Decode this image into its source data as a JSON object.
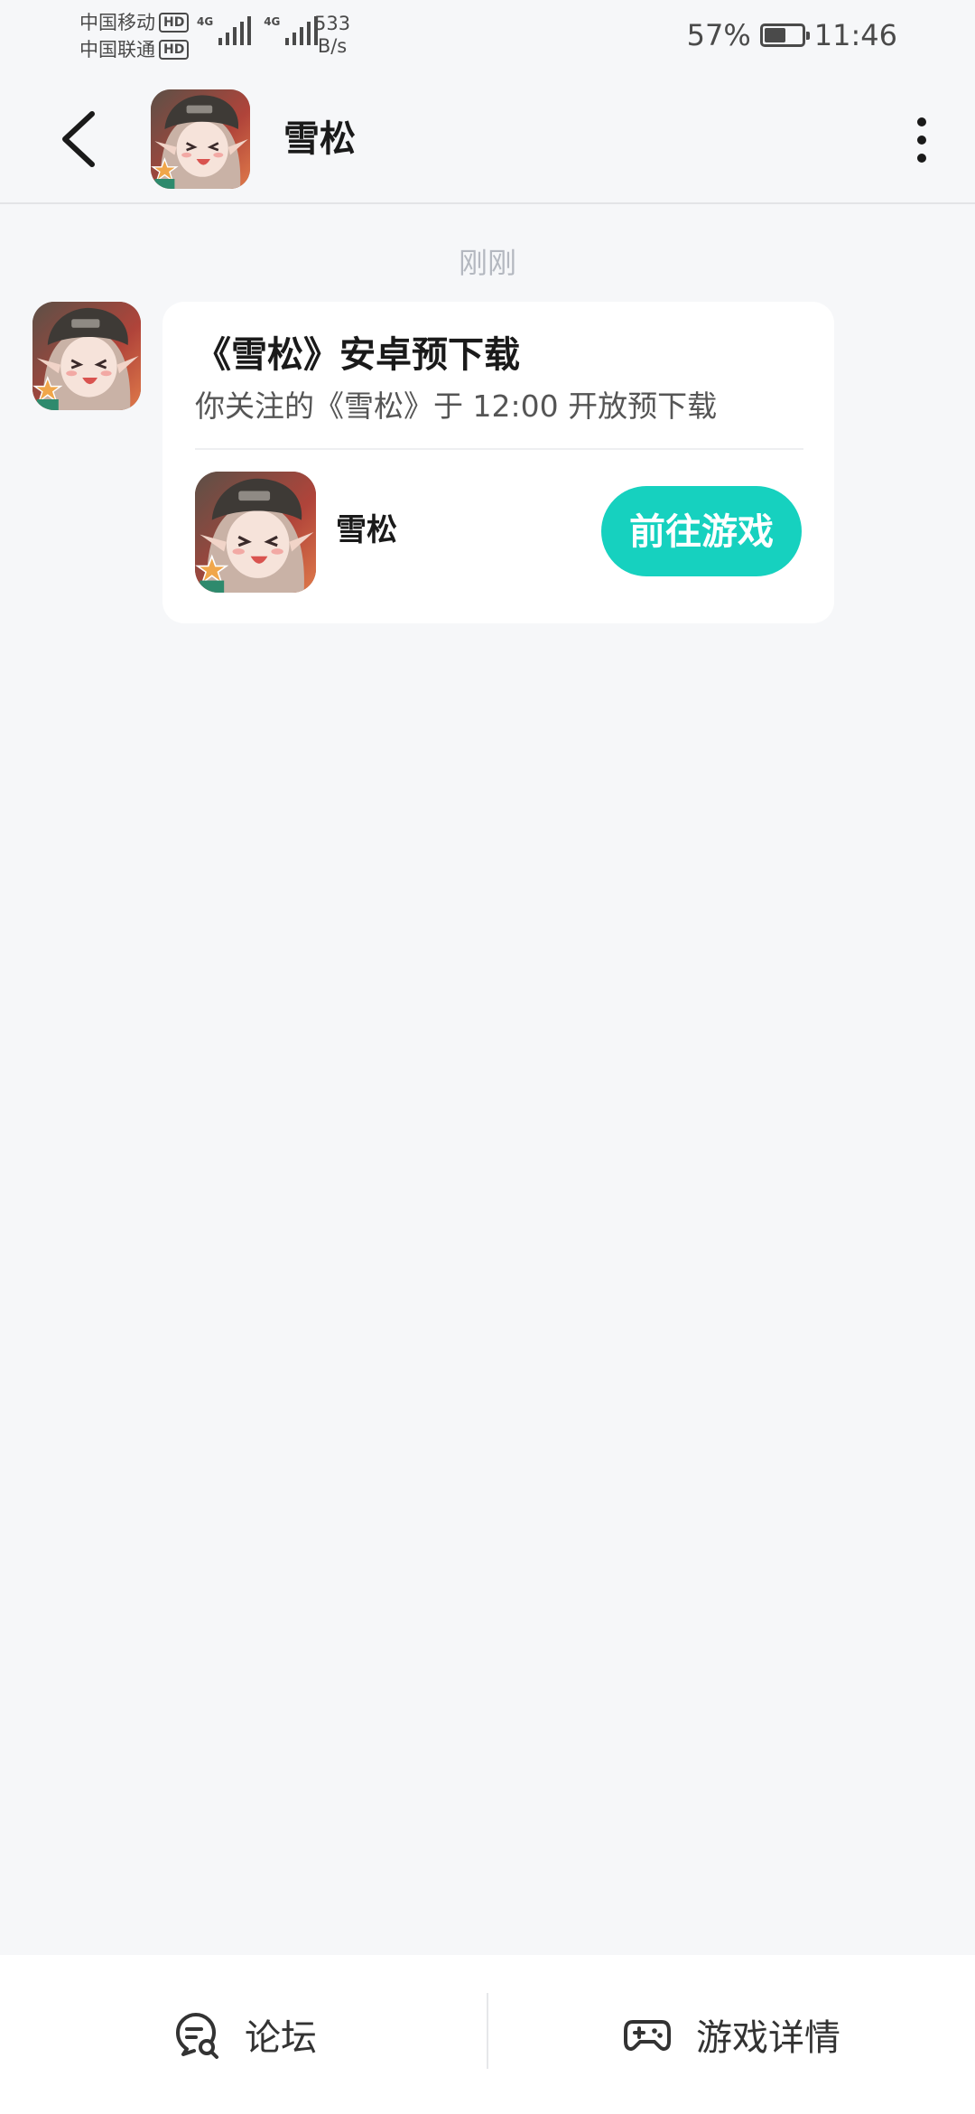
{
  "status_bar": {
    "carrier_1": "中国移动",
    "carrier_2": "中国联通",
    "hd_label": "HD",
    "network_type": "4G",
    "net_speed_value": "533",
    "net_speed_unit": "B/s",
    "battery_percent": "57%",
    "battery_level": 0.57,
    "time": "11:46"
  },
  "header": {
    "title": "雪松",
    "back_icon": "chevron-left-icon",
    "more_icon": "vertical-dots-icon"
  },
  "chat": {
    "timestamp": "刚刚",
    "message": {
      "title": "《雪松》安卓预下载",
      "subtitle": "你关注的《雪松》于 12:00 开放预下载",
      "game_name": "雪松",
      "action_label": "前往游戏"
    }
  },
  "bottom_bar": {
    "forum_label": "论坛",
    "forum_icon": "forum-chat-icon",
    "game_detail_label": "游戏详情",
    "game_detail_icon": "gamepad-icon"
  },
  "colors": {
    "accent": "#16D1BF",
    "background": "#F6F7F9",
    "card": "#FFFFFF",
    "timestamp": "#B4B8C0"
  }
}
